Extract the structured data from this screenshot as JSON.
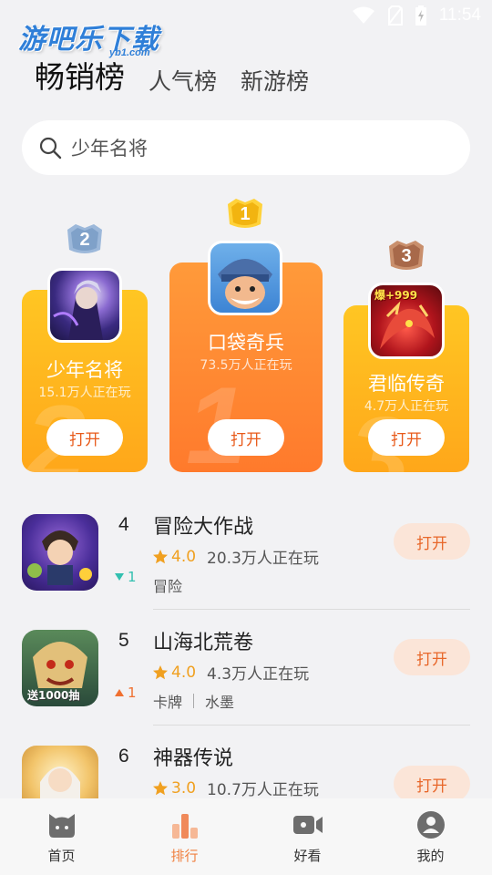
{
  "status_bar": {
    "time": "11:54"
  },
  "watermark": {
    "text": "游吧乐下载",
    "sub": "yb1.com"
  },
  "tabs": [
    {
      "label": "畅销榜",
      "active": true
    },
    {
      "label": "人气榜",
      "active": false
    },
    {
      "label": "新游榜",
      "active": false
    }
  ],
  "search": {
    "placeholder": "少年名将"
  },
  "podium": [
    {
      "rank": "1",
      "name": "口袋奇兵",
      "players": "73.5万人正在玩",
      "button": "打开"
    },
    {
      "rank": "2",
      "name": "少年名将",
      "players": "15.1万人正在玩",
      "button": "打开"
    },
    {
      "rank": "3",
      "name": "君临传奇",
      "players": "4.7万人正在玩",
      "button": "打开"
    }
  ],
  "podium_icon_text": {
    "third_badge": "爆+999"
  },
  "list": [
    {
      "rank": "4",
      "name": "冒险大作战",
      "rating": "4.0",
      "players": "20.3万人正在玩",
      "tags": [
        "冒险"
      ],
      "trend": "1",
      "trend_dir": "down",
      "button": "打开"
    },
    {
      "rank": "5",
      "name": "山海北荒卷",
      "rating": "4.0",
      "players": "4.3万人正在玩",
      "tags": [
        "卡牌",
        "水墨"
      ],
      "trend": "1",
      "trend_dir": "up",
      "button": "打开",
      "icon_text": "送1000抽"
    },
    {
      "rank": "6",
      "name": "神器传说",
      "rating": "3.0",
      "players": "10.7万人正在玩",
      "tags": [],
      "trend": "",
      "trend_dir": "",
      "button": "打开"
    }
  ],
  "bottom_nav": [
    {
      "label": "首页",
      "icon": "home-cat-icon",
      "active": false
    },
    {
      "label": "排行",
      "icon": "ranking-bars-icon",
      "active": true
    },
    {
      "label": "好看",
      "icon": "video-camera-icon",
      "active": false
    },
    {
      "label": "我的",
      "icon": "profile-avatar-icon",
      "active": false
    }
  ],
  "colors": {
    "accent": "#f08040",
    "gold": "#ffb71f",
    "orange": "#ff8a30",
    "star": "#f0a020"
  }
}
